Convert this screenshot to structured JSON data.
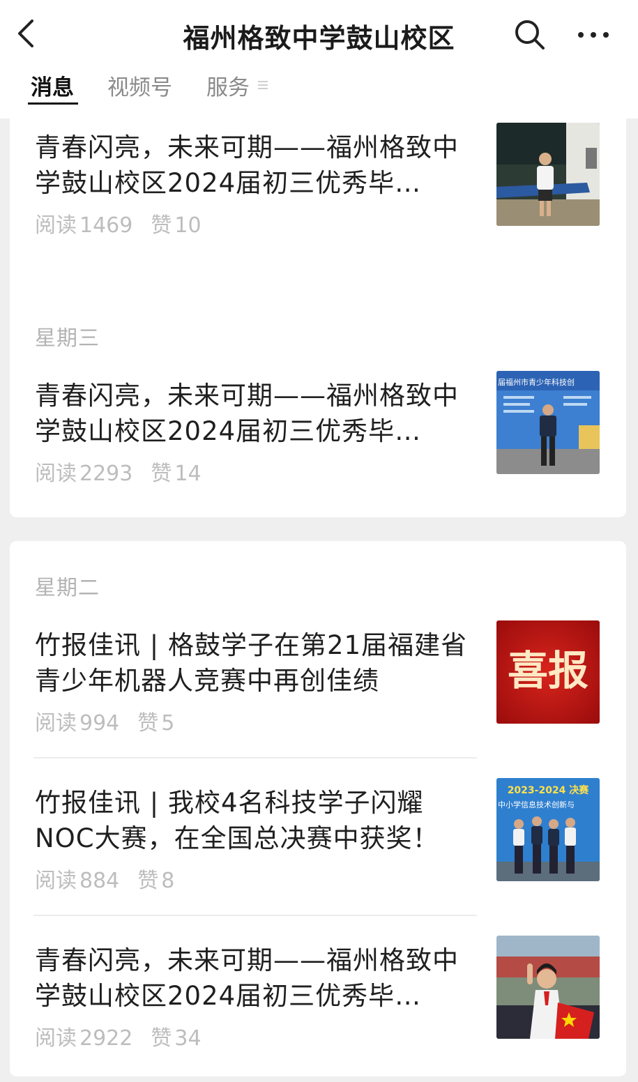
{
  "header": {
    "title": "福州格致中学鼓山校区",
    "icons": [
      "back-icon",
      "search-icon",
      "more-icon"
    ]
  },
  "tabs": [
    {
      "label": "消息",
      "active": true
    },
    {
      "label": "视频号",
      "active": false
    },
    {
      "label": "服务",
      "active": false
    }
  ],
  "sections": [
    {
      "day": "",
      "articles": [
        {
          "title": "青春闪亮，未来可期——福州格致中学鼓山校区2024届初三优秀毕…",
          "read_label": "阅读",
          "reads": "1469",
          "like_label": "赞",
          "likes": "10",
          "thumb": "student-ping-pong-photo"
        }
      ]
    },
    {
      "day": "星期三",
      "articles": [
        {
          "title": "青春闪亮，未来可期——福州格致中学鼓山校区2024届初三优秀毕…",
          "read_label": "阅读",
          "reads": "2293",
          "like_label": "赞",
          "likes": "14",
          "thumb": "student-science-contest-photo",
          "thumb_text": "届福州市青少年科技创"
        }
      ]
    },
    {
      "day": "星期二",
      "articles": [
        {
          "title": "竹报佳讯 | 格鼓学子在第21届福建省青少年机器人竞赛中再创佳绩",
          "read_label": "阅读",
          "reads": "994",
          "like_label": "赞",
          "likes": "5",
          "thumb": "good-news-banner",
          "thumb_text": "喜报"
        },
        {
          "title": "竹报佳讯 | 我校4名科技学子闪耀NOC大赛，在全国总决赛中获奖！",
          "read_label": "阅读",
          "reads": "884",
          "like_label": "赞",
          "likes": "8",
          "thumb": "noc-finals-photo",
          "thumb_text": "2023-2024 决赛",
          "thumb_text2": "中小学信息技术创新与"
        },
        {
          "title": "青春闪亮，未来可期——福州格致中学鼓山校区2024届初三优秀毕…",
          "read_label": "阅读",
          "reads": "2922",
          "like_label": "赞",
          "likes": "34",
          "thumb": "student-flag-photo"
        }
      ]
    }
  ],
  "colors": {
    "background": "#efefef",
    "card": "#ffffff",
    "meta": "#bdbdbd",
    "title": "#1f1f1f"
  }
}
